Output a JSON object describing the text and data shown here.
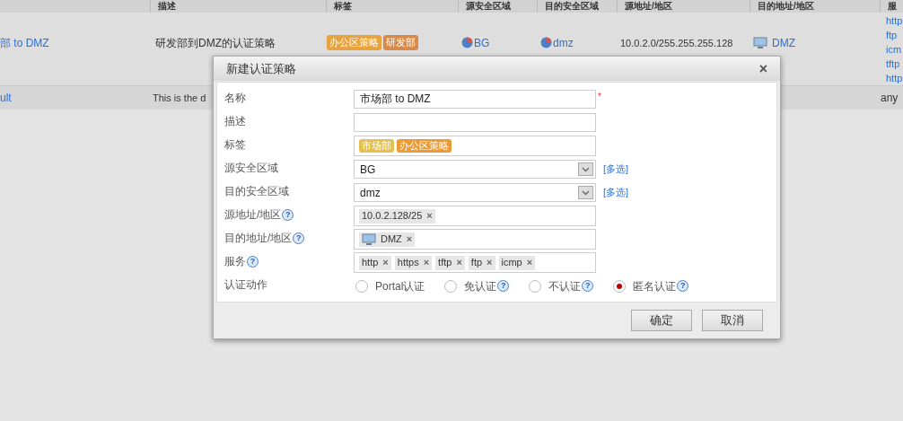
{
  "table": {
    "columns": [
      "描述",
      "标签",
      "源安全区域",
      "目的安全区域",
      "源地址/地区",
      "目的地址/地区",
      "服"
    ],
    "rows": [
      {
        "name": "部 to DMZ",
        "description": "研发部到DMZ的认证策略",
        "tags": [
          {
            "label": "办公区策略",
            "color": "#e8a33c"
          },
          {
            "label": "研发部",
            "color": "#d98a4a"
          }
        ],
        "src_zone": "BG",
        "dst_zone": "dmz",
        "src_addr": "10.0.2.0/255.255.255.128",
        "dst_addr": "DMZ",
        "services": [
          "http",
          "ftp",
          "icm",
          "tftp",
          "http"
        ]
      },
      {
        "name": "ult",
        "description": "This is the d",
        "services": [
          "any"
        ]
      }
    ]
  },
  "dialog": {
    "title": "新建认证策略",
    "close": "×",
    "fields": [
      {
        "kind": "text",
        "label": "名称",
        "value": "市场部 to DMZ",
        "required": "*"
      },
      {
        "kind": "text",
        "label": "描述"
      },
      {
        "kind": "tags",
        "label": "标签",
        "tags": [
          {
            "label": "市场部",
            "color": "#e3c04f"
          },
          {
            "label": "办公区策略",
            "color": "#eb9b36"
          }
        ]
      },
      {
        "kind": "select",
        "label": "源安全区域",
        "value": "BG",
        "link": "[多选]"
      },
      {
        "kind": "select",
        "label": "目的安全区域",
        "value": "dmz",
        "link": "[多选]"
      },
      {
        "kind": "chips",
        "label": "源地址/地区",
        "help": "?",
        "chips": [
          {
            "label": "10.0.2.128/25",
            "remove": "×"
          }
        ]
      },
      {
        "kind": "chips",
        "label": "目的地址/地区",
        "help": "?",
        "chips": [
          {
            "label": "DMZ",
            "remove": "×",
            "monitor": true
          }
        ]
      },
      {
        "kind": "chips",
        "label": "服务",
        "help": "?",
        "chips": [
          {
            "label": "http",
            "remove": "×"
          },
          {
            "label": "https",
            "remove": "×"
          },
          {
            "label": "tftp",
            "remove": "×"
          },
          {
            "label": "ftp",
            "remove": "×"
          },
          {
            "label": "icmp",
            "remove": "×"
          }
        ]
      },
      {
        "kind": "radio",
        "label": "认证动作",
        "options": [
          {
            "label": "Portal认证",
            "selected": false
          },
          {
            "label": "免认证",
            "help": "?",
            "selected": false
          },
          {
            "label": "不认证",
            "help": "?",
            "selected": false
          },
          {
            "label": "匿名认证",
            "help": "?",
            "selected": true
          }
        ]
      }
    ],
    "buttons": [
      "确定",
      "取消"
    ]
  }
}
